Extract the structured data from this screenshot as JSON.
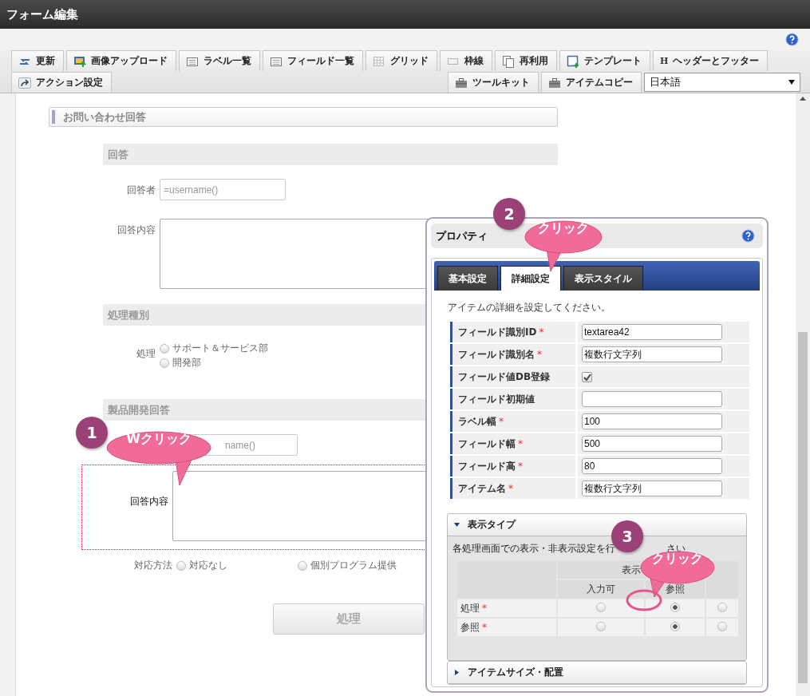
{
  "window": {
    "title": "フォーム編集"
  },
  "toolbar": {
    "row_1": [
      {
        "label": "更新"
      },
      {
        "label": "画像アップロード"
      },
      {
        "label": "ラベル一覧"
      },
      {
        "label": "フィールド一覧"
      },
      {
        "label": "グリッド"
      },
      {
        "label": "枠線"
      },
      {
        "label": "再利用"
      },
      {
        "label": "テンプレート"
      },
      {
        "label": "ヘッダーとフッター",
        "glyph": "H"
      }
    ],
    "row_2_left": [
      {
        "label": "アクション設定"
      }
    ],
    "row_2_right": [
      {
        "label": "ツールキット"
      },
      {
        "label": "アイテムコピー"
      }
    ],
    "language_select": {
      "value": "日本語"
    }
  },
  "form": {
    "section_title": "お問い合わせ回答",
    "groups": [
      {
        "title": "回答",
        "rows": [
          {
            "kind": "input",
            "label": "回答者",
            "placeholder": "=username()",
            "selected": false
          },
          {
            "kind": "textarea",
            "label": "回答内容",
            "selected": false
          }
        ]
      },
      {
        "title": "処理種別",
        "rows": [
          {
            "kind": "radio_list",
            "label": "処理",
            "selected": false,
            "options": [
              {
                "label": "サポート＆サービス部",
                "selected": false
              },
              {
                "label": "開発部",
                "selected": false
              }
            ]
          }
        ]
      },
      {
        "title": "製品開発回答",
        "rows": [
          {
            "kind": "input",
            "placeholder": "name()",
            "selected": false
          },
          {
            "kind": "textarea",
            "label": "回答内容",
            "selected": true
          },
          {
            "kind": "radio_row",
            "label": "対応方法",
            "selected": false,
            "options": [
              {
                "label": "対応なし",
                "selected": false
              },
              {
                "label": "個別プログラム提供",
                "selected": false
              }
            ]
          }
        ]
      }
    ],
    "button": "処理"
  },
  "panel": {
    "title": "プロパティ",
    "tabs": [
      {
        "label": "基本設定",
        "selected": false
      },
      {
        "label": "詳細設定",
        "selected": true
      },
      {
        "label": "表示スタイル",
        "selected": false
      }
    ],
    "instruction": "アイテムの詳細を設定してください。",
    "fields": [
      {
        "label": "フィールド識別ID",
        "required_mark": "*",
        "kind": "text",
        "value": "textarea42"
      },
      {
        "label": "フィールド識別名",
        "required_mark": "*",
        "kind": "text",
        "value": "複数行文字列"
      },
      {
        "label": "フィールド値DB登録",
        "kind": "checkbox",
        "checked": true
      },
      {
        "label": "フィールド初期値",
        "kind": "text"
      },
      {
        "label": "ラベル幅",
        "required_mark": "*",
        "kind": "text",
        "value": "100"
      },
      {
        "label": "フィールド幅",
        "required_mark": "*",
        "kind": "text",
        "value": "500"
      },
      {
        "label": "フィールド高",
        "required_mark": "*",
        "kind": "text",
        "value": "80"
      },
      {
        "label": "アイテム名",
        "required_mark": "*",
        "kind": "text",
        "value": "複数行文字列"
      }
    ],
    "sections": [
      {
        "title": "表示タイプ",
        "expanded": true,
        "instruction_parts": [
          "各処理画面での表示・非表示設定を行",
          "さい"
        ],
        "grid": {
          "group_header": "表示",
          "columns": [
            "入力可",
            "参照"
          ],
          "rows": [
            {
              "label": "処理",
              "required_mark": "*",
              "cells": [
                {
                  "selected": false
                },
                {
                  "selected": true
                },
                {
                  "selected": false
                }
              ]
            },
            {
              "label": "参照",
              "required_mark": "*",
              "cells": [
                {
                  "selected": false
                },
                {
                  "selected": true
                },
                {
                  "selected": false
                }
              ]
            }
          ]
        }
      },
      {
        "title": "アイテムサイズ・配置",
        "expanded": false
      }
    ]
  },
  "callouts": [
    {
      "number": "1",
      "text": "Wクリック"
    },
    {
      "number": "2",
      "text": "クリック"
    },
    {
      "number": "3",
      "text": "クリック"
    }
  ]
}
